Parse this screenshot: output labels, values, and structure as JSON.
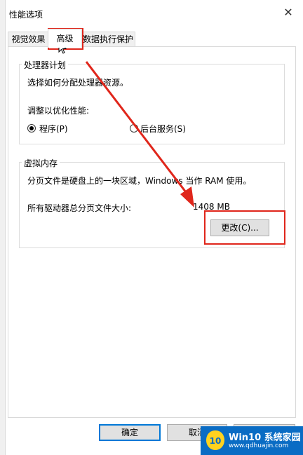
{
  "window": {
    "title": "性能选项",
    "close_glyph": "✕"
  },
  "tabs": [
    {
      "label": "视觉效果",
      "active": false
    },
    {
      "label": "高级",
      "active": true
    },
    {
      "label": "数据执行保护",
      "active": false
    }
  ],
  "processor": {
    "group_title": "处理器计划",
    "description": "选择如何分配处理器资源。",
    "adjust_label": "调整以优化性能:",
    "options": [
      {
        "label": "程序(P)",
        "selected": true
      },
      {
        "label": "后台服务(S)",
        "selected": false
      }
    ]
  },
  "virtual_memory": {
    "group_title": "虚拟内存",
    "description": "分页文件是硬盘上的一块区域，Windows 当作 RAM 使用。",
    "total_label": "所有驱动器总分页文件大小:",
    "total_value": "1408 MB",
    "change_button": "更改(C)..."
  },
  "footer": {
    "ok_button": "确定",
    "cancel_button": "取消"
  },
  "watermark": {
    "brand": "Win10 系统家园",
    "url": "www.qdhuajin.com",
    "mark": "10"
  },
  "annotation_color": "#e0261b",
  "accent_color": "#0078d7"
}
